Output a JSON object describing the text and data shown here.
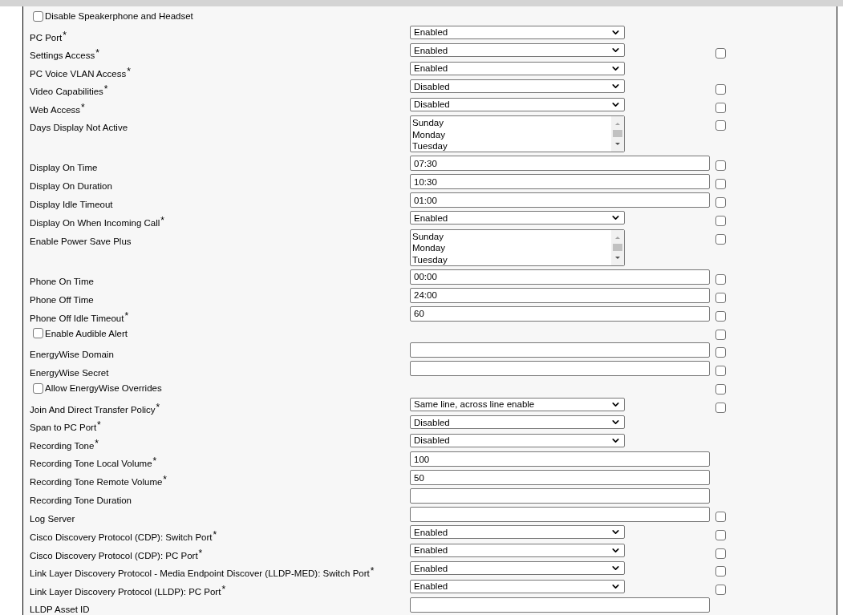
{
  "rows": [
    {
      "kind": "checkbox",
      "label": "Disable Speakerphone and Headset",
      "checked": false
    },
    {
      "kind": "select",
      "label": "PC Port",
      "asterisk": "*",
      "value": "Enabled"
    },
    {
      "kind": "select",
      "label": "Settings Access",
      "asterisk": "*",
      "value": "Enabled",
      "override_checked": false
    },
    {
      "kind": "select",
      "label": "PC Voice VLAN Access",
      "asterisk": "*",
      "value": "Enabled"
    },
    {
      "kind": "select",
      "label": "Video Capabilities",
      "asterisk": "*",
      "value": "Disabled",
      "override_checked": false
    },
    {
      "kind": "select",
      "label": "Web Access",
      "asterisk": "*",
      "value": "Disabled",
      "override_checked": false
    },
    {
      "kind": "listbox",
      "label": "Days Display Not Active",
      "options": [
        "Sunday",
        "Monday",
        "Tuesday"
      ],
      "override_checked": false
    },
    {
      "kind": "text",
      "label": "Display On Time",
      "value": "07:30",
      "override_checked": false
    },
    {
      "kind": "text",
      "label": "Display On Duration",
      "value": "10:30",
      "override_checked": false
    },
    {
      "kind": "text",
      "label": "Display Idle Timeout",
      "value": "01:00",
      "override_checked": false
    },
    {
      "kind": "select",
      "label": "Display On When Incoming Call",
      "asterisk": "*",
      "value": "Enabled",
      "override_checked": false
    },
    {
      "kind": "listbox",
      "label": "Enable Power Save Plus",
      "options": [
        "Sunday",
        "Monday",
        "Tuesday"
      ],
      "override_checked": false
    },
    {
      "kind": "text",
      "label": "Phone On Time",
      "value": "00:00",
      "override_checked": false
    },
    {
      "kind": "text",
      "label": "Phone Off Time",
      "value": "24:00",
      "override_checked": false
    },
    {
      "kind": "text",
      "label": "Phone Off Idle Timeout",
      "asterisk": "*",
      "value": "60",
      "override_checked": false
    },
    {
      "kind": "checkbox",
      "label": "Enable Audible Alert",
      "checked": false,
      "override_checked": false
    },
    {
      "kind": "text",
      "label": "EnergyWise Domain",
      "override_checked": false
    },
    {
      "kind": "text",
      "label": "EnergyWise Secret",
      "override_checked": false
    },
    {
      "kind": "checkbox",
      "label": "Allow EnergyWise Overrides",
      "checked": false,
      "override_checked": false
    },
    {
      "kind": "select",
      "label": "Join And Direct Transfer Policy",
      "asterisk": "*",
      "value": "Same line, across line enable",
      "override_checked": false
    },
    {
      "kind": "select",
      "label": "Span to PC Port",
      "asterisk": "*",
      "value": "Disabled"
    },
    {
      "kind": "select",
      "label": "Recording Tone",
      "asterisk": "*",
      "value": "Disabled"
    },
    {
      "kind": "text",
      "label": "Recording Tone Local Volume",
      "asterisk": "*",
      "value": "100"
    },
    {
      "kind": "text",
      "label": "Recording Tone Remote Volume",
      "asterisk": "*",
      "value": "50"
    },
    {
      "kind": "text",
      "label": "Recording Tone Duration"
    },
    {
      "kind": "text",
      "label": "Log Server",
      "override_checked": false
    },
    {
      "kind": "select",
      "label": "Cisco Discovery Protocol (CDP): Switch Port",
      "asterisk": "*",
      "value": "Enabled",
      "override_checked": false
    },
    {
      "kind": "select",
      "label": "Cisco Discovery Protocol (CDP): PC Port",
      "asterisk": "*",
      "value": "Enabled",
      "override_checked": false
    },
    {
      "kind": "select",
      "label": "Link Layer Discovery Protocol - Media Endpoint Discover (LLDP-MED): Switch Port",
      "asterisk": "*",
      "value": "Enabled",
      "override_checked": false
    },
    {
      "kind": "select",
      "label": "Link Layer Discovery Protocol (LLDP): PC Port",
      "asterisk": "*",
      "value": "Enabled",
      "override_checked": false
    },
    {
      "kind": "text",
      "label": "LLDP Asset ID"
    }
  ]
}
